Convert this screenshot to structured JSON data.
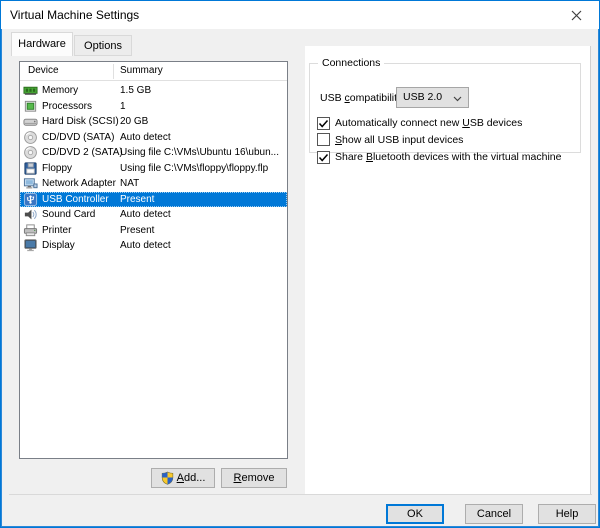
{
  "window": {
    "title": "Virtual Machine Settings",
    "close": "close"
  },
  "colors": {
    "accent": "#0078d7",
    "selection": "#0078d7",
    "titlebar": "#ffffff",
    "dialog_bg": "#f0f0f0",
    "panel_bg": "#ffffff"
  },
  "tabs": [
    {
      "label": "Hardware",
      "active": true
    },
    {
      "label": "Options",
      "active": false
    }
  ],
  "device_list": {
    "columns": {
      "device": "Device",
      "summary": "Summary"
    },
    "rows": [
      {
        "icon": "memory-icon",
        "device": "Memory",
        "summary": "1.5 GB",
        "selected": false
      },
      {
        "icon": "processor-icon",
        "device": "Processors",
        "summary": "1",
        "selected": false
      },
      {
        "icon": "hard-disk-icon",
        "device": "Hard Disk (SCSI)",
        "summary": "20 GB",
        "selected": false
      },
      {
        "icon": "cd-icon",
        "device": "CD/DVD (SATA)",
        "summary": "Auto detect",
        "selected": false
      },
      {
        "icon": "cd-icon",
        "device": "CD/DVD 2 (SATA)",
        "summary": "Using file C:\\VMs\\Ubuntu 16\\ubun...",
        "selected": false
      },
      {
        "icon": "floppy-icon",
        "device": "Floppy",
        "summary": "Using file C:\\VMs\\floppy\\floppy.flp",
        "selected": false
      },
      {
        "icon": "network-icon",
        "device": "Network Adapter",
        "summary": "NAT",
        "selected": false
      },
      {
        "icon": "usb-icon",
        "device": "USB Controller",
        "summary": "Present",
        "selected": true
      },
      {
        "icon": "sound-icon",
        "device": "Sound Card",
        "summary": "Auto detect",
        "selected": false
      },
      {
        "icon": "printer-icon",
        "device": "Printer",
        "summary": "Present",
        "selected": false
      },
      {
        "icon": "display-icon",
        "device": "Display",
        "summary": "Auto detect",
        "selected": false
      }
    ]
  },
  "list_buttons": {
    "add": {
      "pre": "",
      "key": "A",
      "post": "dd..."
    },
    "remove": {
      "pre": "",
      "key": "R",
      "post": "emove"
    }
  },
  "connections": {
    "group_label": "Connections",
    "usb_compatibility": {
      "label_pre": "USB ",
      "label_key": "c",
      "label_post": "ompatibility:",
      "value": "USB 2.0"
    },
    "checkboxes": [
      {
        "pre": "Automatically connect new ",
        "key": "U",
        "post": "SB devices",
        "checked": true
      },
      {
        "pre": "",
        "key": "S",
        "post": "how all USB input devices",
        "checked": false
      },
      {
        "pre": "Share ",
        "key": "B",
        "post": "luetooth devices with the virtual machine",
        "checked": true
      }
    ]
  },
  "dialog_buttons": {
    "ok": "OK",
    "cancel": "Cancel",
    "help": "Help"
  }
}
